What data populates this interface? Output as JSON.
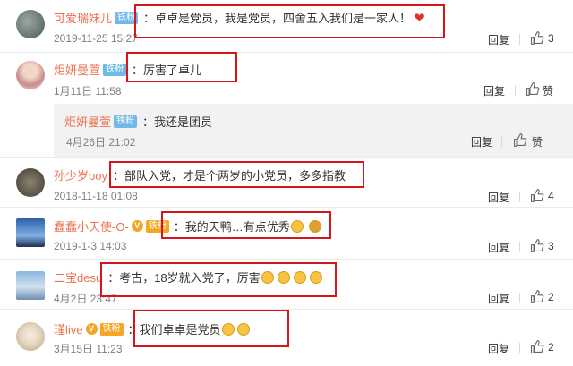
{
  "colors": {
    "username": "#eb7350",
    "highlight_box": "#d7141a",
    "badge": "#6fb8e8",
    "quote_bg": "#f2f2f5"
  },
  "comments": [
    {
      "user": "可爱瑞妹儿",
      "badge": "铁粉",
      "text": "：卓卓是党员，我是党员，四舍五入我们是一家人！",
      "emoji": "heart",
      "time": "2019-11-25 15:27",
      "reply": "回复",
      "likes": "3"
    },
    {
      "user": "炬妍曼萱",
      "badge": "铁粉",
      "text": "：厉害了卓儿",
      "time": "1月11日 11:58",
      "reply": "回复",
      "likes": "赞"
    },
    {
      "user": "炬妍曼萱",
      "badge": "铁粉",
      "text": "：我还是团员",
      "time": "4月26日 21:02",
      "reply": "回复",
      "likes": "赞"
    },
    {
      "user": "孙少岁boy",
      "text": "：部队入党，才是个两岁的小党员，多多指教",
      "time": "2018-11-18 01:08",
      "reply": "回复",
      "likes": "4"
    },
    {
      "user": "蠢蠢小天使-O-",
      "badge": "铁粉",
      "text": "：我的天鸭…有点优秀",
      "time": "2019-1-3 14:03",
      "reply": "回复",
      "likes": "3"
    },
    {
      "user": "二宝desu",
      "text": "：考古，18岁就入党了，厉害",
      "time": "4月2日 23:47",
      "reply": "回复",
      "likes": "2"
    },
    {
      "user": "瑾live",
      "badge": "铁粉",
      "text": "：我们卓卓是党员",
      "time": "3月15日 11:23",
      "reply": "回复",
      "likes": "2"
    }
  ]
}
